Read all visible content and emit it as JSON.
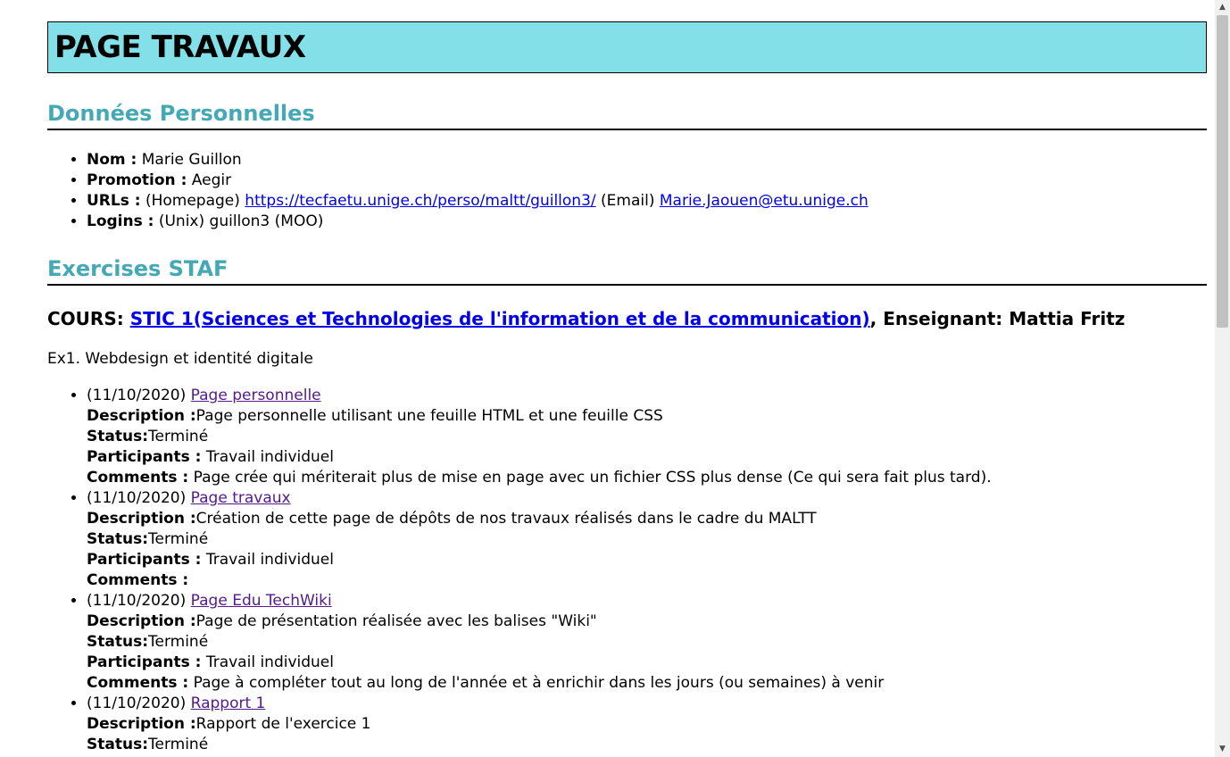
{
  "title": "PAGE TRAVAUX",
  "personal": {
    "heading": "Données Personnelles",
    "nom_label": "Nom :",
    "nom_value": " Marie Guillon",
    "promotion_label": "Promotion :",
    "promotion_value": " Aegir",
    "urls_label": "URLs :",
    "urls_homepage_prefix": " (Homepage) ",
    "urls_homepage_link": "https://tecfaetu.unige.ch/perso/maltt/guillon3/",
    "urls_email_prefix": " (Email) ",
    "urls_email_link": "Marie.Jaouen@etu.unige.ch",
    "logins_label": "Logins :",
    "logins_value": " (Unix) guillon3 (MOO)"
  },
  "exercises": {
    "heading": "Exercises STAF",
    "course_prefix": "COURS: ",
    "course_link": "STIC 1(Sciences et Technologies de l'information et de la communication)",
    "course_suffix": ", Enseignant: Mattia Fritz",
    "ex1_title": "Ex1. Webdesign et identité digitale",
    "items": [
      {
        "date": "(11/10/2020) ",
        "link": "Page personnelle",
        "description_label": "Description :",
        "description": "Page personnelle utilisant une feuille HTML et une feuille CSS",
        "status_label": "Status:",
        "status": "Terminé",
        "participants_label": "Participants :",
        "participants": " Travail individuel",
        "comments_label": "Comments :",
        "comments": " Page crée qui mériterait plus de mise en page avec un fichier CSS plus dense (Ce qui sera fait plus tard)."
      },
      {
        "date": "(11/10/2020) ",
        "link": "Page travaux",
        "description_label": "Description :",
        "description": "Création de cette page de dépôts de nos travaux réalisés dans le cadre du MALTT",
        "status_label": "Status:",
        "status": "Terminé",
        "participants_label": "Participants :",
        "participants": " Travail individuel",
        "comments_label": "Comments :",
        "comments": ""
      },
      {
        "date": "(11/10/2020) ",
        "link": "Page Edu TechWiki",
        "description_label": "Description :",
        "description": "Page de présentation réalisée avec les balises \"Wiki\"",
        "status_label": "Status:",
        "status": "Terminé",
        "participants_label": "Participants :",
        "participants": " Travail individuel",
        "comments_label": "Comments :",
        "comments": " Page à compléter tout au long de l'année et à enrichir dans les jours (ou semaines) à venir"
      },
      {
        "date": "(11/10/2020) ",
        "link": "Rapport 1",
        "description_label": "Description :",
        "description": "Rapport de l'exercice 1",
        "status_label": "Status:",
        "status": "Terminé"
      }
    ]
  }
}
